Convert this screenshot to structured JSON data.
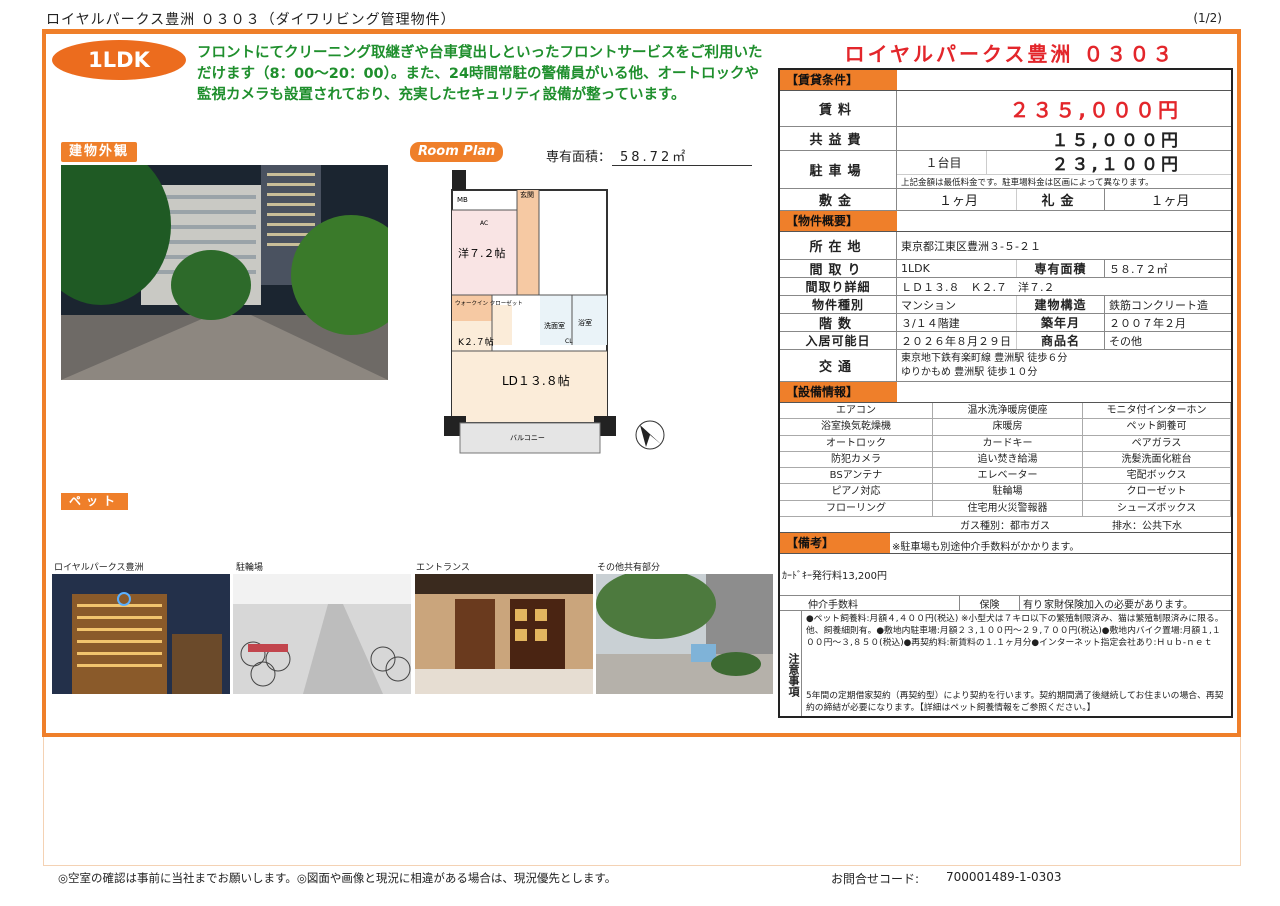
{
  "header": {
    "title": "ロイヤルパークス豊洲 ０３０３（ダイワリビング管理物件）",
    "page": "(1/2)"
  },
  "room_type": "1LDK",
  "catch_copy": "フロントにてクリーニング取継ぎや台車貸出しといったフロントサービスをご利用いただけます（8：00〜20：00）。また、24時間常駐の警備員がいる他、オートロックや監視カメラも設置されており、充実したセキュリティ設備が整っています。",
  "labels": {
    "exterior": "建物外観",
    "room_plan": "Room Plan",
    "area_label": "専有面積：",
    "pet": "ペット"
  },
  "area_value": "58.72㎡",
  "floorplan": {
    "mb": "MB",
    "entrance": "玄関",
    "ac": "AC",
    "western": "洋７.２帖",
    "walkin": "ウォークイン クローゼット",
    "kitchen": "K２.７帖",
    "washroom": "洗面室",
    "bath": "浴室",
    "cl": "CL",
    "ldk": "LD１３.８帖",
    "balcony": "バルコニー"
  },
  "thumbs": [
    {
      "caption": "ロイヤルパークス豊洲"
    },
    {
      "caption": "駐輪場"
    },
    {
      "caption": "エントランス"
    },
    {
      "caption": "その他共有部分"
    }
  ],
  "property_name": "ロイヤルパークス豊洲 ０３０３",
  "rent": {
    "section": "【賃貸条件】",
    "rent_label": "賃料",
    "rent_value": "２３５,０００円",
    "common_label": "共益費",
    "common_value": "１５,０００円",
    "parking_label": "駐車場",
    "parking_slot": "１台目",
    "parking_value": "２３,１００円",
    "parking_note": "上記金額は最低料金です。駐車場料金は区画によって異なります。",
    "deposit_label": "敷金",
    "deposit_value": "１ヶ月",
    "key_label": "礼金",
    "key_value": "１ヶ月"
  },
  "overview": {
    "section": "【物件概要】",
    "addr_label": "所在地",
    "addr": "東京都江東区豊洲３-５-２１",
    "layout_label": "間取り",
    "layout": "1LDK",
    "area_label": "専有面積",
    "area": "５８.７２㎡",
    "detail_label": "間取り詳細",
    "detail": "ＬＤ１３.８　Ｋ２.７　洋７.２",
    "type_label": "物件種別",
    "type": "マンション",
    "struct_label": "建物構造",
    "struct": "鉄筋コンクリート造",
    "floor_label": "階数",
    "floor": "３/１４階建",
    "built_label": "築年月",
    "built": "２００７年２月",
    "move_label": "入居可能日",
    "move": "２０２６年８月２９日",
    "product_label": "商品名",
    "product": "その他",
    "traffic_label": "交通",
    "traffic1": "東京地下鉄有楽町線 豊洲駅 徒歩６分",
    "traffic2": "ゆりかもめ 豊洲駅 徒歩１０分"
  },
  "equipment": {
    "section": "【設備情報】",
    "items": [
      "エアコン",
      "温水洗浄暖房便座",
      "モニタ付インターホン",
      "浴室換気乾燥機",
      "床暖房",
      "ペット飼養可",
      "オートロック",
      "カードキー",
      "ペアガラス",
      "防犯カメラ",
      "追い焚き給湯",
      "洗髪洗面化粧台",
      "BSアンテナ",
      "エレベーター",
      "宅配ボックス",
      "ピアノ対応",
      "駐輪場",
      "クローゼット",
      "フローリング",
      "住宅用火災警報器",
      "シューズボックス"
    ],
    "gas": "ガス種別：都市ガス",
    "drain": "排水：公共下水"
  },
  "remarks": {
    "section": "【備考】",
    "note": "※駐車場も別途仲介手数料がかかります。",
    "card": "ｶｰﾄﾞｷｰ発行料13,200円",
    "broker_label": "仲介手数料",
    "ins_label": "保険",
    "ins_value": "有り",
    "ins_note": "家財保険加入の必要があります。",
    "caution_label": "注意事項",
    "caution1": "●ペット飼養料:月額４,４００円(税込) ※小型犬は７キロ以下の繁殖制限済み、猫は繁殖制限済みに限る。他、飼養細則有。●敷地内駐車場:月額２３,１００円〜２９,７００円(税込)●敷地内バイク置場:月額１,１００円〜３,８５０(税込)●再契約料:新賃料の１.１ヶ月分●インターネット指定会社あり:Ｈｕｂ-ｎｅｔ",
    "caution2": "5年間の定期借家契約（再契約型）により契約を行います。契約期間満了後継続してお住まいの場合、再契約の締結が必要になります。【詳細はペット飼養情報をご参照ください。】"
  },
  "footer": {
    "note": "◎空室の確認は事前に当社までお願いします。◎図面や画像と現況に相違がある場合は、現況優先とします。",
    "inquiry_label": "お問合せコード:",
    "inquiry_code": "700001489-1-0303"
  },
  "colors": {
    "accent": "#ef7f2a",
    "rent_red": "#e3262b",
    "catch_green": "#1f8f2d"
  }
}
